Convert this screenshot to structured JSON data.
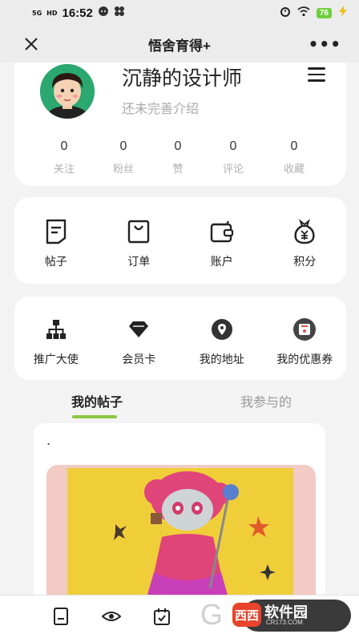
{
  "status_bar": {
    "network": "5G",
    "hd": "HD",
    "time": "16:52",
    "battery": "76"
  },
  "nav": {
    "title": "悟舍育得+",
    "more": "•••"
  },
  "profile": {
    "username": "沉静的设计师",
    "bio": "还未完善介绍"
  },
  "stats": [
    {
      "value": "0",
      "label": "关注"
    },
    {
      "value": "0",
      "label": "粉丝"
    },
    {
      "value": "0",
      "label": "赞"
    },
    {
      "value": "0",
      "label": "评论"
    },
    {
      "value": "0",
      "label": "收藏"
    }
  ],
  "quick_menu": [
    {
      "label": "帖子",
      "icon": "post-icon"
    },
    {
      "label": "订单",
      "icon": "shopping-bag-icon"
    },
    {
      "label": "账户",
      "icon": "wallet-icon"
    },
    {
      "label": "积分",
      "icon": "money-bag-icon"
    }
  ],
  "service_menu": [
    {
      "label": "推广大使",
      "icon": "org-chart-icon"
    },
    {
      "label": "会员卡",
      "icon": "diamond-icon"
    },
    {
      "label": "我的地址",
      "icon": "location-pin-icon"
    },
    {
      "label": "我的优惠券",
      "icon": "coupon-icon"
    }
  ],
  "tabs": {
    "active": "我的帖子",
    "inactive": "我参与的"
  },
  "post": {
    "text": "."
  },
  "watermark": {
    "logo": "西西",
    "name": "软件园",
    "domain": "CR173.COM"
  },
  "colors": {
    "accent_green": "#8cc63f",
    "avatar_bg": "#2aa870",
    "battery": "#6fcf3d"
  }
}
